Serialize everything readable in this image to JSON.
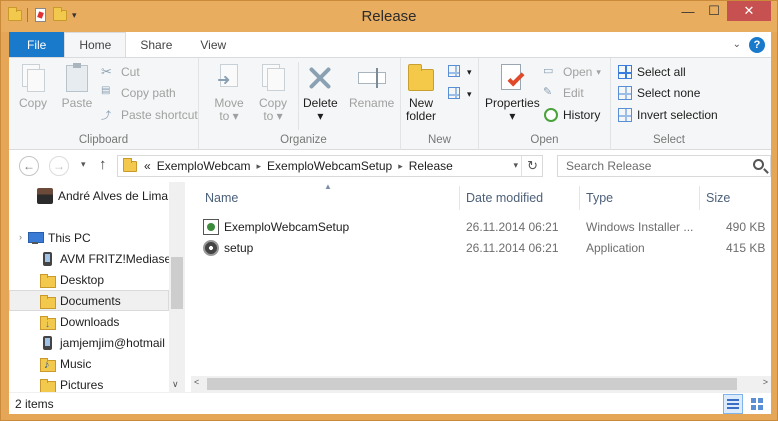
{
  "window": {
    "title": "Release"
  },
  "ribbon_tabs": {
    "file": "File",
    "home": "Home",
    "share": "Share",
    "view": "View"
  },
  "clipboard": {
    "label": "Clipboard",
    "copy": "Copy",
    "paste": "Paste",
    "cut": "Cut",
    "copy_path": "Copy path",
    "paste_shortcut": "Paste shortcut"
  },
  "organize": {
    "label": "Organize",
    "move_to": [
      "Move",
      "to"
    ],
    "copy_to": [
      "Copy",
      "to"
    ],
    "delete": "Delete",
    "rename": "Rename"
  },
  "new_group": {
    "label": "New",
    "new_folder": [
      "New",
      "folder"
    ]
  },
  "open_group": {
    "label": "Open",
    "properties": "Properties",
    "open": "Open",
    "edit": "Edit",
    "history": "History"
  },
  "select_group": {
    "label": "Select",
    "select_all": "Select all",
    "select_none": "Select none",
    "invert": "Invert selection"
  },
  "address": {
    "overflow": "«",
    "crumbs": [
      "ExemploWebcam",
      "ExemploWebcamSetup",
      "Release"
    ],
    "search_placeholder": "Search Release"
  },
  "nav_pane": {
    "user": "André Alves de Lima",
    "this_pc": "This PC",
    "items": [
      "AVM FRITZ!Mediaserver",
      "Desktop",
      "Documents",
      "Downloads",
      "jamjemjim@hotmail",
      "Music",
      "Pictures"
    ]
  },
  "columns": {
    "name": "Name",
    "date": "Date modified",
    "type": "Type",
    "size": "Size"
  },
  "files": [
    {
      "name": "ExemploWebcamSetup",
      "date": "26.11.2014 06:21",
      "type": "Windows Installer ...",
      "size": "490 KB",
      "icon": "msi-installer-icon"
    },
    {
      "name": "setup",
      "date": "26.11.2014 06:21",
      "type": "Application",
      "size": "415 KB",
      "icon": "setup-exe-icon"
    }
  ],
  "status": {
    "count": "2 items"
  },
  "colors": {
    "accent": "#1979ca",
    "title_bar": "#e8ad5f",
    "close": "#c75050"
  }
}
